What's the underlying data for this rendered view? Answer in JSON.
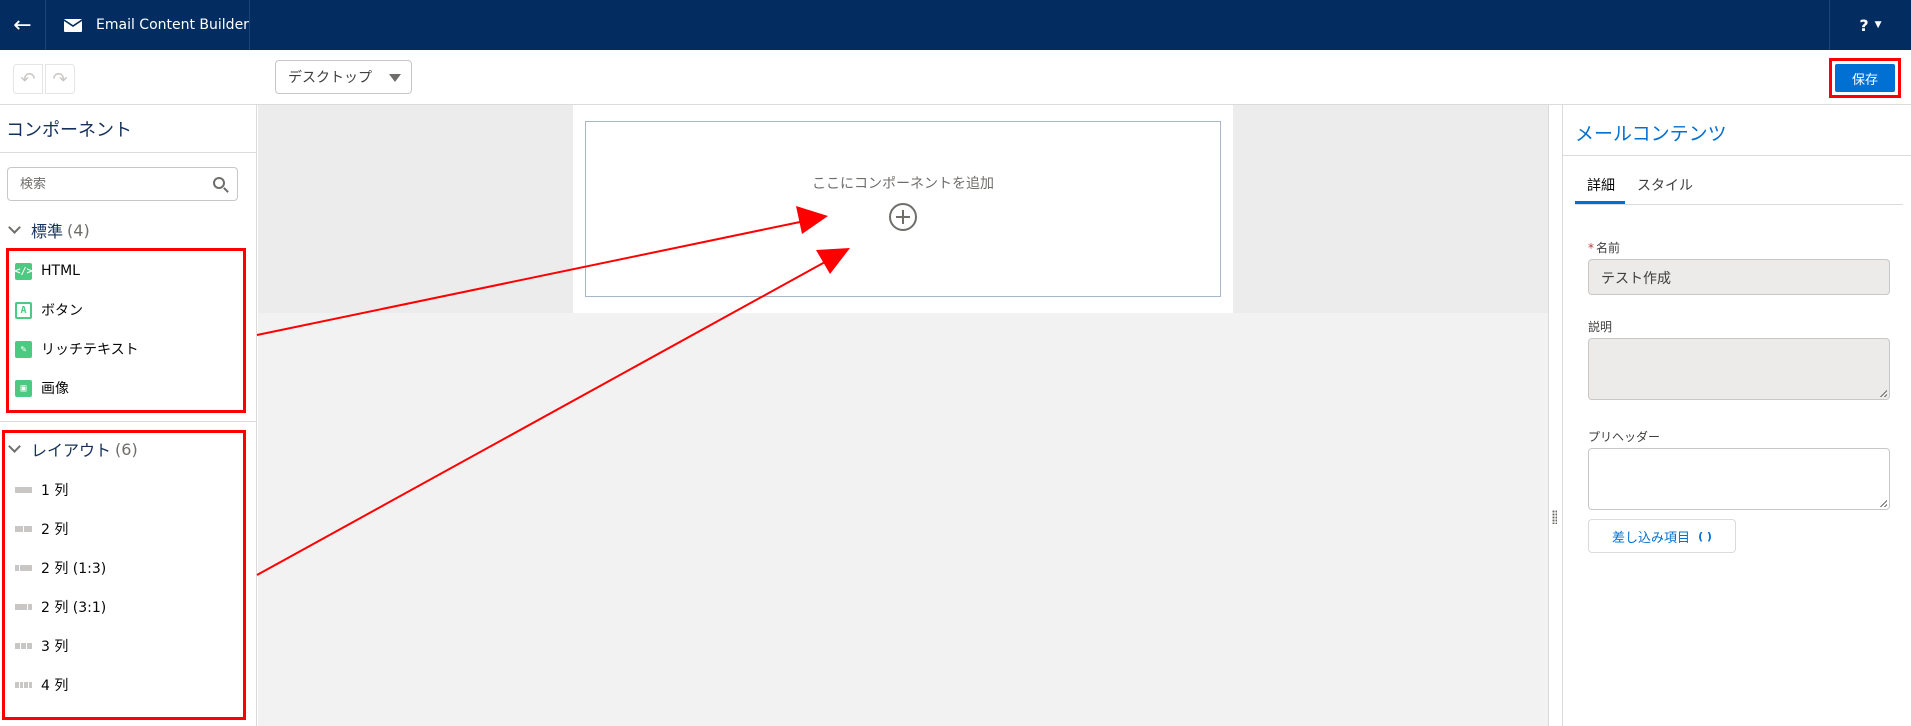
{
  "topbar": {
    "title": "Email Content Builder",
    "help_label": "?",
    "colors": {
      "bar": "#032d60"
    }
  },
  "toolbar": {
    "undo_icon": "undo-icon",
    "redo_icon": "redo-icon",
    "device": "デスクトップ",
    "save_label": "保存",
    "colors": {
      "save": "#0070d2"
    }
  },
  "components_panel": {
    "title": "コンポーネント",
    "search_placeholder": "検索",
    "standard": {
      "label": "標準",
      "count": "(4)",
      "items": [
        {
          "label": "HTML",
          "icon": "html-icon"
        },
        {
          "label": "ボタン",
          "icon": "button-icon"
        },
        {
          "label": "リッチテキスト",
          "icon": "rich-text-icon"
        },
        {
          "label": "画像",
          "icon": "image-icon"
        }
      ]
    },
    "layout": {
      "label": "レイアウト",
      "count": "(6)",
      "items": [
        {
          "label": "1 列"
        },
        {
          "label": "2 列"
        },
        {
          "label": "2 列 (1:3)"
        },
        {
          "label": "2 列 (3:1)"
        },
        {
          "label": "3 列"
        },
        {
          "label": "4 列"
        }
      ]
    }
  },
  "canvas": {
    "dropzone_label": "ここにコンポーネントを追加"
  },
  "properties_panel": {
    "title": "メールコンテンツ",
    "tabs": [
      {
        "label": "詳細",
        "active": true
      },
      {
        "label": "スタイル",
        "active": false
      }
    ],
    "name": {
      "required_mark": "*",
      "label": "名前",
      "value": "テスト作成"
    },
    "description": {
      "label": "説明",
      "value": ""
    },
    "preheader": {
      "label": "プリヘッダー",
      "value": ""
    },
    "merge_button": "差し込み項目",
    "merge_icon": "( )"
  },
  "annotation": {
    "highlight_color": "#ff0000"
  }
}
